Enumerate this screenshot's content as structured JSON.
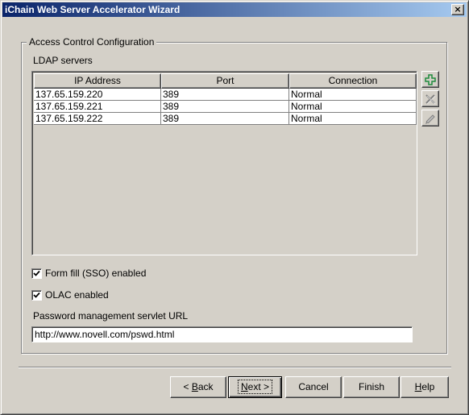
{
  "window": {
    "title": "iChain Web Server Accelerator Wizard",
    "close_glyph": "×"
  },
  "group": {
    "title": "Access Control Configuration"
  },
  "ldap": {
    "label": "LDAP servers",
    "columns": [
      "IP Address",
      "Port",
      "Connection"
    ],
    "rows": [
      [
        "137.65.159.220",
        "389",
        "Normal"
      ],
      [
        "137.65.159.221",
        "389",
        "Normal"
      ],
      [
        "137.65.159.222",
        "389",
        "Normal"
      ]
    ],
    "actions": [
      {
        "icon": "plus-icon",
        "enabled": true
      },
      {
        "icon": "delete-x-icon",
        "enabled": false
      },
      {
        "icon": "pencil-icon",
        "enabled": false
      }
    ]
  },
  "options": {
    "form_fill": {
      "label": "Form fill (SSO) enabled",
      "checked": true
    },
    "olac": {
      "label": "OLAC enabled",
      "checked": true
    }
  },
  "password": {
    "label": "Password management servlet URL",
    "value": "http://www.novell.com/pswd.html"
  },
  "buttons": {
    "back": {
      "prefix": "< ",
      "mnemonic": "B",
      "rest": "ack"
    },
    "next": {
      "mnemonic": "N",
      "rest": "ext >"
    },
    "cancel": "Cancel",
    "finish": "Finish",
    "help": {
      "mnemonic": "H",
      "rest": "elp"
    }
  },
  "colors": {
    "titlebar_start": "#0a246a",
    "titlebar_end": "#a6caf0",
    "face": "#d4d0c8",
    "plus_icon": "#1e8a3c"
  }
}
